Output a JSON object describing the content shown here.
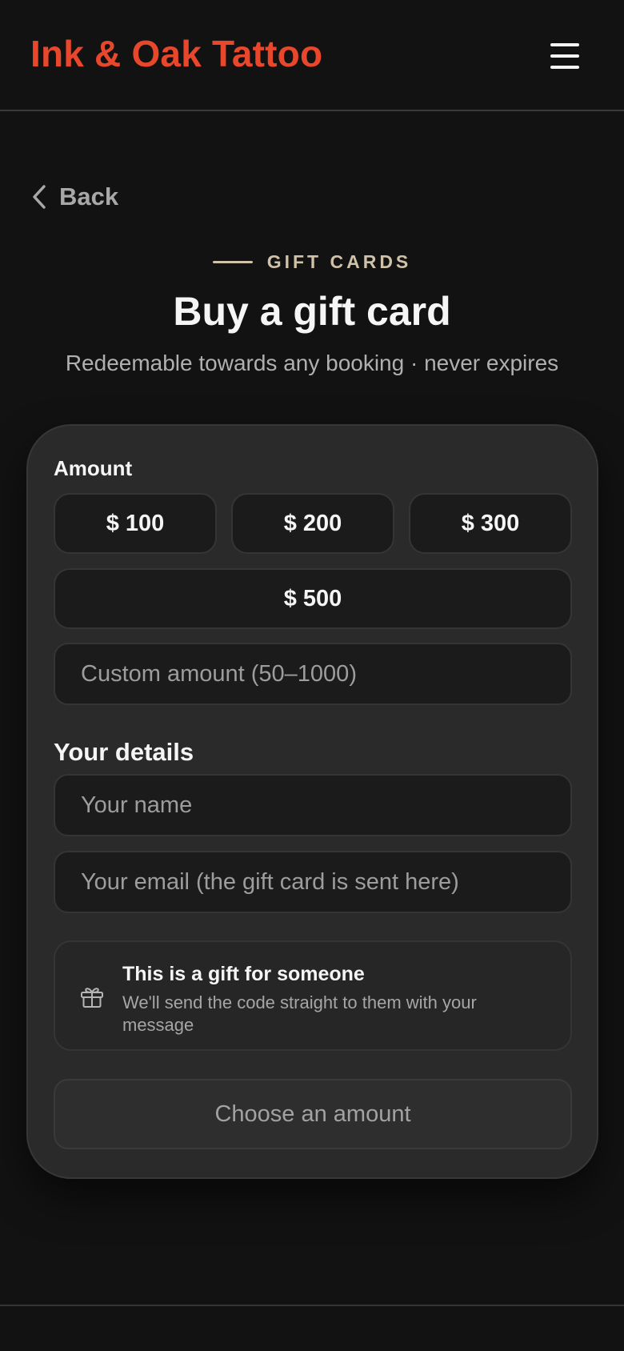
{
  "header": {
    "brand": "Ink & Oak Tattoo",
    "menu_icon": "hamburger-icon"
  },
  "nav": {
    "back_label": "Back",
    "back_icon": "chevron-left-icon"
  },
  "hero": {
    "eyebrow": "GIFT CARDS",
    "title": "Buy a gift card",
    "subtitle": "Redeemable towards any booking · never expires"
  },
  "form": {
    "amount_label": "Amount",
    "amounts": [
      "$ 100",
      "$ 200",
      "$ 300",
      "$ 500"
    ],
    "custom_amount": {
      "value": "",
      "placeholder": "Custom amount (50–1000)"
    },
    "details_label": "Your details",
    "name_field": {
      "value": "",
      "placeholder": "Your name"
    },
    "email_field": {
      "value": "",
      "placeholder": "Your email (the gift card is sent here)"
    },
    "gift_toggle": {
      "icon": "gift-icon",
      "title": "This is a gift for someone",
      "description": "We'll send the code straight to them with your message"
    },
    "submit_label": "Choose an amount"
  },
  "colors": {
    "brand": "#e8472c",
    "accent_eyebrow": "#cfc2a8",
    "background": "#121212",
    "card": "#2a2a2a"
  }
}
